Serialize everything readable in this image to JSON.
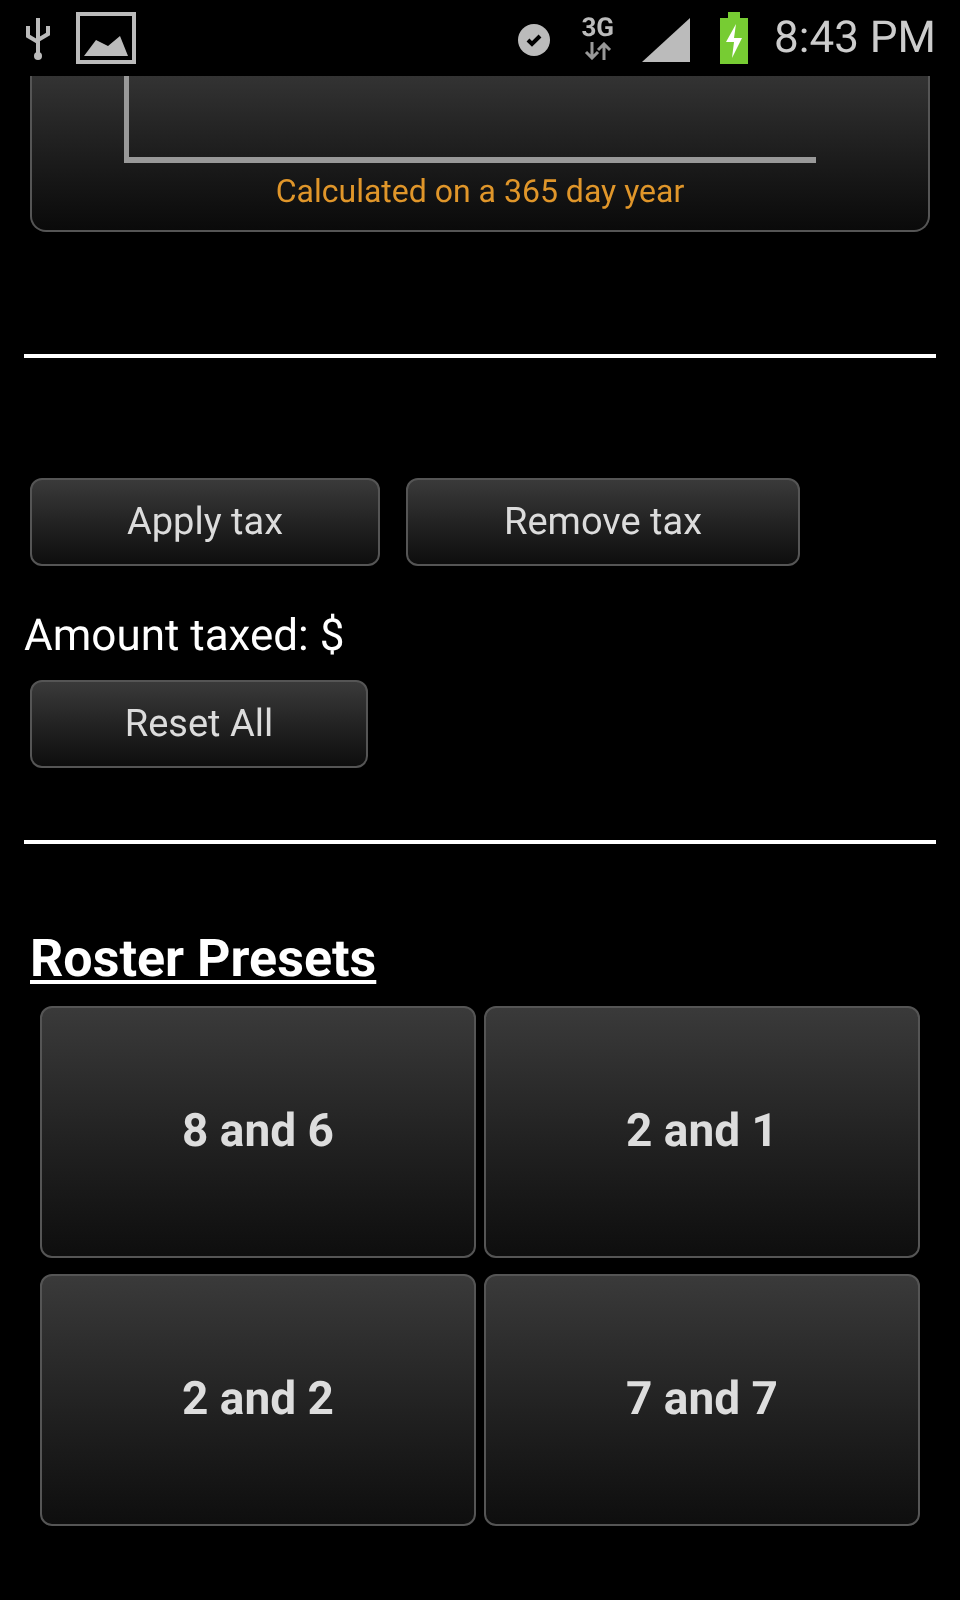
{
  "status_bar": {
    "network": "3G",
    "time": "8:43 PM"
  },
  "summary_card": {
    "note": "Calculated on a 365 day year"
  },
  "tax_buttons": [
    "Apply tax",
    "Remove tax"
  ],
  "amount_taxed": "Amount taxed: $",
  "reset_button": "Reset All",
  "roster_presets": {
    "title": "Roster Presets",
    "items": [
      "8 and 6",
      "2 and 1",
      "2 and 2",
      "7 and 7"
    ]
  }
}
